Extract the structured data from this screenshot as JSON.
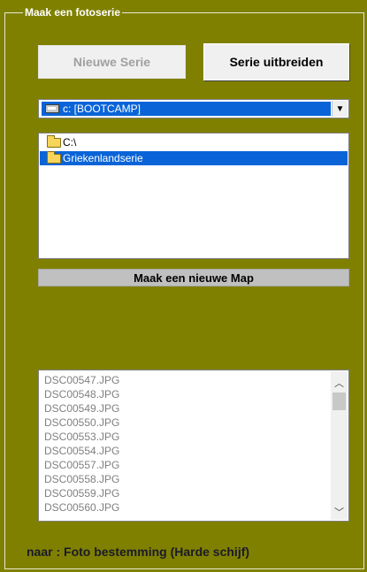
{
  "group": {
    "title": "Maak een fotoserie"
  },
  "buttons": {
    "new_series": "Nieuwe Serie",
    "extend_series": "Serie uitbreiden",
    "new_folder": "Maak een nieuwe Map"
  },
  "drive": {
    "selected": "c: [BOOTCAMP]",
    "icon": "drive-icon"
  },
  "directories": [
    {
      "label": "C:\\",
      "icon": "folder-open-icon"
    },
    {
      "label": "Griekenlandserie",
      "icon": "folder-open-icon"
    }
  ],
  "files": [
    "DSC00547.JPG",
    "DSC00548.JPG",
    "DSC00549.JPG",
    "DSC00550.JPG",
    "DSC00553.JPG",
    "DSC00554.JPG",
    "DSC00557.JPG",
    "DSC00558.JPG",
    "DSC00559.JPG",
    "DSC00560.JPG"
  ],
  "footer": {
    "text": "naar :  Foto bestemming (Harde schijf)"
  },
  "colors": {
    "background": "#808000",
    "selection": "#0a64d8"
  }
}
